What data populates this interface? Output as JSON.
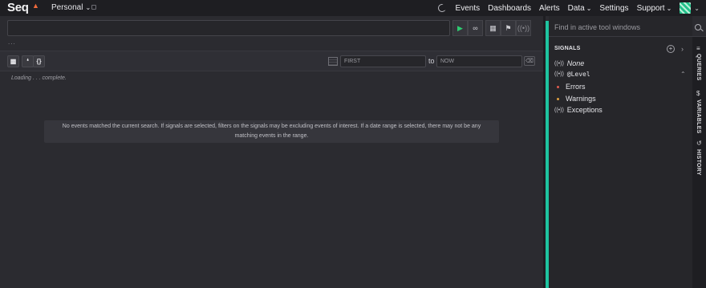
{
  "header": {
    "logo": "Seq",
    "workspace": "Personal",
    "nav": [
      {
        "label": "Events",
        "dropdown": false
      },
      {
        "label": "Dashboards",
        "dropdown": false
      },
      {
        "label": "Alerts",
        "dropdown": false
      },
      {
        "label": "Data",
        "dropdown": true
      },
      {
        "label": "Settings",
        "dropdown": false
      },
      {
        "label": "Support",
        "dropdown": true
      }
    ]
  },
  "search": {
    "placeholder": "",
    "expand_label": "..."
  },
  "range": {
    "from_placeholder": "FIRST",
    "to_label": "to",
    "to_placeholder": "NOW"
  },
  "results": {
    "status": "Loading . . . complete.",
    "empty_message": "No events matched the current search. If signals are selected, filters on the signals may be excluding events of interest. If a date range is selected, there may not be any matching events in the range."
  },
  "panel": {
    "find_placeholder": "Find in active tool windows",
    "signals_title": "SIGNALS",
    "signals": [
      {
        "label": "None",
        "style": "italic"
      },
      {
        "label": "@Level",
        "style": "mono"
      }
    ],
    "levels": [
      {
        "label": "Errors",
        "color": "#e05a4e"
      },
      {
        "label": "Warnings",
        "color": "#e0a040"
      }
    ],
    "other_signals": [
      {
        "label": "Exceptions"
      }
    ],
    "tabs": [
      "QUERIES",
      "VARIABLES",
      "HISTORY"
    ]
  },
  "colors": {
    "accent": "#1ec4a0",
    "logo_flame": "#f06a3c"
  }
}
